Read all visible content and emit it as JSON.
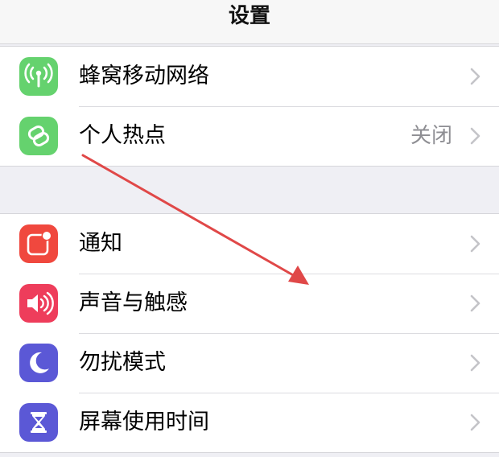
{
  "header": {
    "title": "设置"
  },
  "groups": [
    {
      "items": [
        {
          "label": "蜂窝移动网络",
          "value": "",
          "icon": "cellular-antenna-icon",
          "icon_color": "#65d26e"
        },
        {
          "label": "个人热点",
          "value": "关闭",
          "icon": "personal-hotspot-link-icon",
          "icon_color": "#65d26e"
        }
      ]
    },
    {
      "items": [
        {
          "label": "通知",
          "icon": "notifications-icon",
          "icon_color": "#f0483e"
        },
        {
          "label": "声音与触感",
          "icon": "speaker-icon",
          "icon_color": "#ee3d5b"
        },
        {
          "label": "勿扰模式",
          "icon": "moon-icon",
          "icon_color": "#5b58d6"
        },
        {
          "label": "屏幕使用时间",
          "icon": "hourglass-icon",
          "icon_color": "#5b58d6"
        }
      ]
    }
  ],
  "annotation": {
    "type": "arrow",
    "color": "#e04848"
  }
}
